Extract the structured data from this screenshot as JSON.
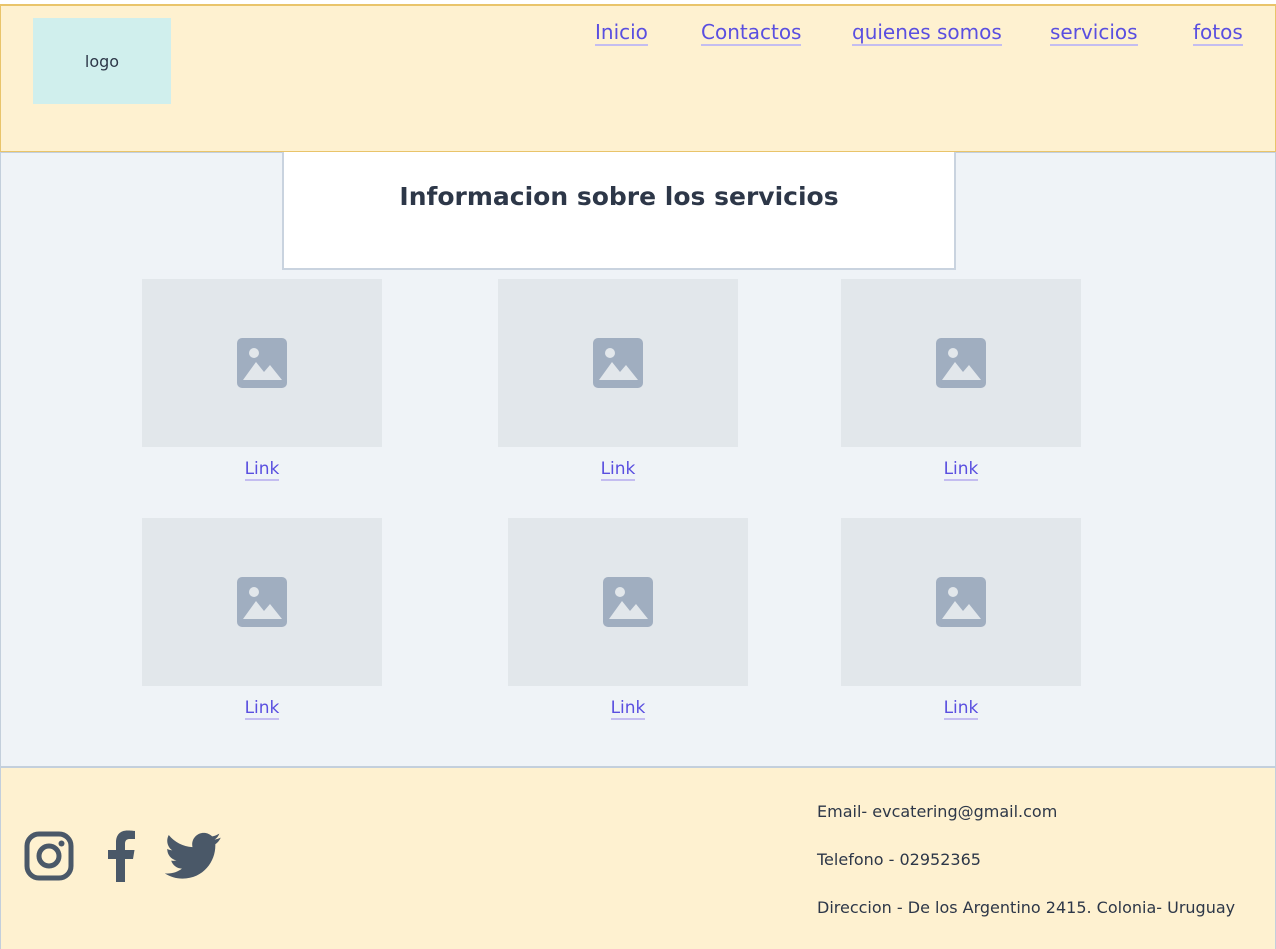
{
  "header": {
    "logo_text": "logo",
    "nav": [
      "Inicio",
      "Contactos",
      "quienes somos",
      "servicios",
      "fotos"
    ]
  },
  "main": {
    "title": "Informacion sobre los servicios",
    "cards": [
      {
        "link": "Link",
        "icon": "image-placeholder-icon"
      },
      {
        "link": "Link",
        "icon": "image-placeholder-icon"
      },
      {
        "link": "Link",
        "icon": "image-placeholder-icon"
      },
      {
        "link": "Link",
        "icon": "image-placeholder-icon"
      },
      {
        "link": "Link",
        "icon": "image-placeholder-icon"
      },
      {
        "link": "Link",
        "icon": "image-placeholder-icon"
      }
    ]
  },
  "footer": {
    "social": [
      "instagram-icon",
      "facebook-icon",
      "twitter-icon"
    ],
    "email": "Email- evcatering@gmail.com",
    "telefono": "Telefono -  02952365",
    "direccion": "Direccion - De los Argentino 2415. Colonia- Uruguay"
  },
  "colors": {
    "header_bg": "#fef1d0",
    "main_bg": "#eff3f7",
    "link": "#5a4fe0",
    "placeholder_bg": "#e2e7eb",
    "placeholder_icon": "#a0aec0",
    "social_icon": "#4a5868"
  }
}
